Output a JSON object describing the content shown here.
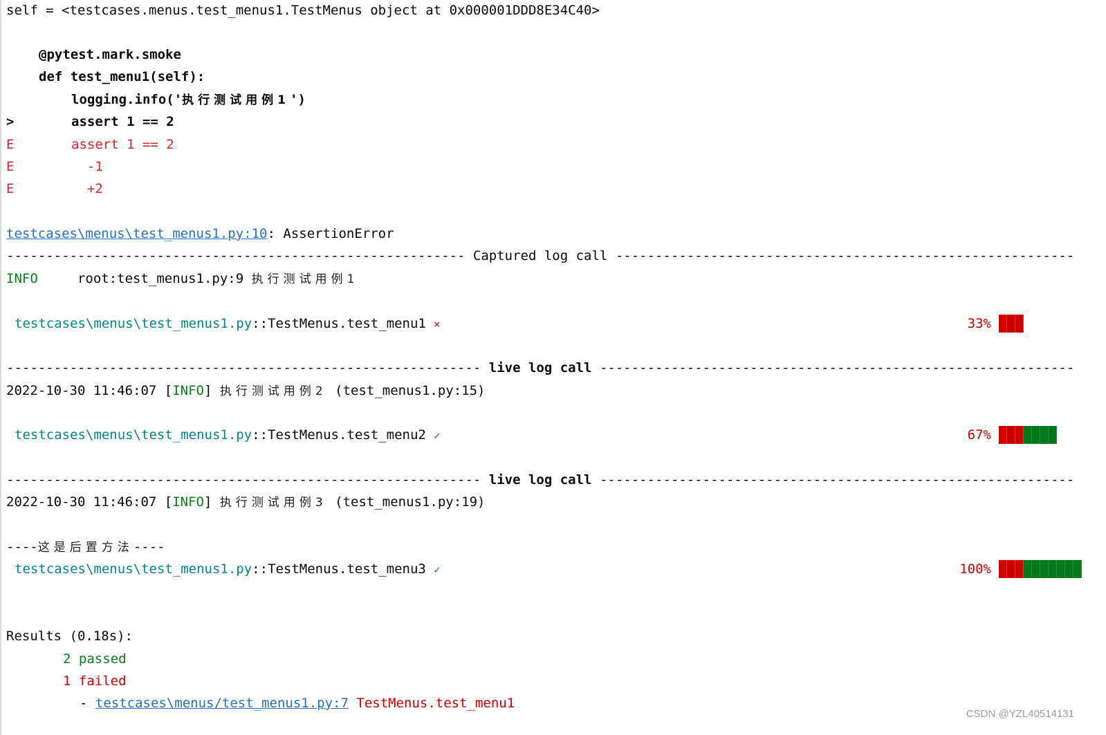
{
  "traceback": {
    "self_line": "self = <testcases.menus.test_menus1.TestMenus object at 0x000001DDD8E34C40>",
    "decorator": "@pytest.mark.smoke",
    "def_line": "def test_menu1(self):",
    "logging_prefix": "logging.info('",
    "logging_cjk": "执行测试用例1",
    "logging_suffix": "')",
    "marker_arrow": ">",
    "assert_line": "assert 1 == 2",
    "errors": [
      {
        "marker": "E",
        "text": "assert 1 == 2"
      },
      {
        "marker": "E",
        "text": "  -1"
      },
      {
        "marker": "E",
        "text": "  +2"
      }
    ],
    "location_link": "testcases\\menus\\test_menus1.py:10",
    "location_suffix": ": AssertionError"
  },
  "captured": {
    "separator_title": "Captured log call",
    "level": "INFO",
    "source": "root:test_menus1.py:9 ",
    "message": "执行测试用例1"
  },
  "tests": [
    {
      "path": "testcases\\menus\\test_menus1.py",
      "name": "::TestMenus.test_menu1",
      "status_icon": "×",
      "status": "failed",
      "percent": "33%",
      "progress": 0.33
    },
    {
      "path": "testcases\\menus\\test_menus1.py",
      "name": "::TestMenus.test_menu2",
      "status_icon": "✓",
      "status": "passed",
      "percent": "67%",
      "progress": 0.67
    },
    {
      "path": "testcases\\menus\\test_menus1.py",
      "name": "::TestMenus.test_menu3",
      "status_icon": "✓",
      "status": "passed",
      "percent": "100%",
      "progress": 1.0
    }
  ],
  "live_logs": [
    {
      "separator_title": "live log call",
      "timestamp": "2022-10-30 11:46:07 [",
      "level": "INFO",
      "close": "] ",
      "message": "执行测试用例2",
      "source": " (test_menus1.py:15)"
    },
    {
      "separator_title": "live log call",
      "timestamp": "2022-10-30 11:46:07 [",
      "level": "INFO",
      "close": "] ",
      "message": "执行测试用例3",
      "source": " (test_menus1.py:19)"
    }
  ],
  "teardown": {
    "dashes_left": "----",
    "message": "这是后置方法",
    "dashes_right": "----"
  },
  "results": {
    "title": "Results (0.18s):",
    "passed": "2 passed",
    "failed": "1 failed",
    "failure_dash": "- ",
    "failure_link": "testcases\\menus/test_menus1.py:7",
    "failure_name": " TestMenus.test_menu1"
  },
  "colors": {
    "error_red": "#e51e1e",
    "progress_red": "#cc0000",
    "progress_green": "#077b1b",
    "teal": "#00878a",
    "link_blue": "#2470c7"
  },
  "watermark": "CSDN @YZL40514131"
}
